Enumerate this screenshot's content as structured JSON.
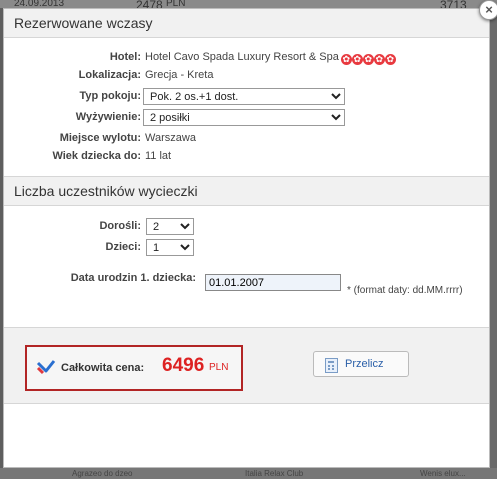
{
  "backdrop": {
    "top_date": "24.09.2013",
    "top_price_prefix": "2478",
    "top_price_cur": "PLN",
    "top_right": "3713",
    "bottom_left": "Agrazeo do dzeo",
    "bottom_mid": "Italia Relax Club",
    "bottom_right": "Wenis elux..."
  },
  "modal": {
    "close_label": "×",
    "section1_title": "Rezerwowane wczasy",
    "details": {
      "hotel_label": "Hotel:",
      "hotel_value": "Hotel Cavo Spada Luxury Resort & Spa",
      "hotel_stars": 5,
      "location_label": "Lokalizacja:",
      "location_value": "Grecja - Kreta",
      "room_label": "Typ pokoju:",
      "room_value": "Pok. 2 os.+1 dost.",
      "board_label": "Wyżywienie:",
      "board_value": "2 posiłki",
      "departure_label": "Miejsce wylotu:",
      "departure_value": "Warszawa",
      "child_age_label": "Wiek dziecka do:",
      "child_age_value": "11 lat"
    },
    "section2_title": "Liczba uczestników wycieczki",
    "participants": {
      "adults_label": "Dorośli:",
      "adults_value": "2",
      "children_label": "Dzieci:",
      "children_value": "1",
      "birthdate_label": "Data urodzin 1. dziecka:",
      "birthdate_value": "01.01.2007",
      "date_hint": "* (format daty: dd.MM.rrrr)"
    },
    "price": {
      "label": "Całkowita cena:",
      "amount": "6496",
      "currency": "PLN"
    },
    "recalc_label": "Przelicz"
  },
  "colors": {
    "accent_red": "#d22222",
    "border_red": "#b22525",
    "link_blue": "#2a5fa8"
  }
}
